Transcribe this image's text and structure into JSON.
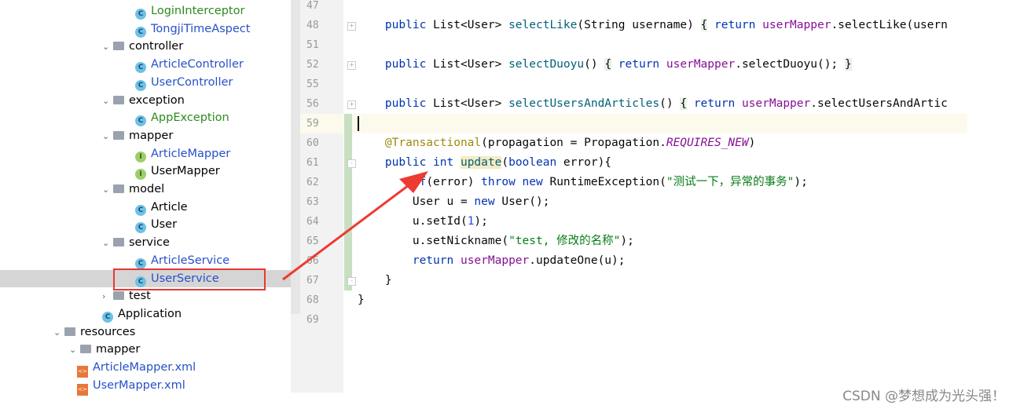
{
  "tree": [
    {
      "label": "LoginInterceptor",
      "type": "class",
      "color": "green",
      "level": 4
    },
    {
      "label": "TongjiTimeAspect",
      "type": "class",
      "color": "blue",
      "level": 4
    },
    {
      "label": "controller",
      "type": "folder",
      "level": 3
    },
    {
      "label": "ArticleController",
      "type": "class",
      "color": "blue",
      "level": 4
    },
    {
      "label": "UserController",
      "type": "class",
      "color": "blue",
      "level": 4
    },
    {
      "label": "exception",
      "type": "folder",
      "level": 3
    },
    {
      "label": "AppException",
      "type": "class",
      "color": "green",
      "level": 4
    },
    {
      "label": "mapper",
      "type": "folder",
      "level": 3
    },
    {
      "label": "ArticleMapper",
      "type": "interface",
      "color": "blue",
      "level": 4
    },
    {
      "label": "UserMapper",
      "type": "interface",
      "color": "",
      "level": 4
    },
    {
      "label": "model",
      "type": "folder",
      "level": 3
    },
    {
      "label": "Article",
      "type": "class",
      "color": "",
      "level": 4
    },
    {
      "label": "User",
      "type": "class",
      "color": "",
      "level": 4
    },
    {
      "label": "service",
      "type": "folder",
      "level": 3
    },
    {
      "label": "ArticleService",
      "type": "class",
      "color": "blue",
      "level": 4
    },
    {
      "label": "UserService",
      "type": "class",
      "color": "blue",
      "level": 4,
      "selected": true
    },
    {
      "label": "test",
      "type": "folder-collapsed",
      "level": 3
    },
    {
      "label": "Application",
      "type": "app",
      "color": "",
      "level": 3
    },
    {
      "label": "resources",
      "type": "folder",
      "level": 1
    },
    {
      "label": "mapper",
      "type": "folder",
      "level": 2
    },
    {
      "label": "ArticleMapper.xml",
      "type": "xml",
      "color": "blue",
      "level": 3
    },
    {
      "label": "UserMapper.xml",
      "type": "xml",
      "color": "blue",
      "level": 3
    }
  ],
  "editor": {
    "line_numbers": [
      "47",
      "48",
      "51",
      "52",
      "55",
      "56",
      "59",
      "60",
      "61",
      "62",
      "63",
      "64",
      "65",
      "66",
      "67",
      "68",
      "69"
    ],
    "lines": [
      "",
      "    <span class=\"kw\">public</span> List&lt;User&gt; <span class=\"fn\">selectLike</span>(String username) <span class=\"hlb\">{</span> <span class=\"kw\">return</span> <span class=\"fld\">userMapper</span>.selectLike(usern",
      "",
      "    <span class=\"kw\">public</span> List&lt;User&gt; <span class=\"fn\">selectDuoyu</span>() <span class=\"hlb\">{</span> <span class=\"kw\">return</span> <span class=\"fld\">userMapper</span>.selectDuoyu(); <span class=\"hlb\">}</span>",
      "",
      "    <span class=\"kw\">public</span> List&lt;User&gt; <span class=\"fn\">selectUsersAndArticles</span>() <span class=\"hlb\">{</span> <span class=\"kw\">return</span> <span class=\"fld\">userMapper</span>.selectUsersAndArtic",
      "",
      "    <span class=\"an\">@Transactional</span>(propagation = Propagation.<span class=\"it\">REQUIRES_NEW</span>)",
      "    <span class=\"kw\">public int</span> <span class=\"fn hly\">update</span>(<span class=\"kw\">boolean</span> error){",
      "        <span class=\"kw\">if</span>(error) <span class=\"kw\">throw new</span> RuntimeException(<span class=\"str\">\"测试一下，异常的事务\"</span>);",
      "        User u = <span class=\"kw\">new</span> User();",
      "        u.setId(<span class=\"num\">1</span>);",
      "        u.setNickname(<span class=\"str\">\"test, 修改的名称\"</span>);",
      "        <span class=\"kw\">return</span> <span class=\"fld\">userMapper</span>.updateOne(u);",
      "    }",
      "}",
      ""
    ]
  },
  "watermark": "CSDN @梦想成为光头强！",
  "colors": {
    "annotation_box": "#e53935",
    "arrow": "#ee3a33"
  }
}
